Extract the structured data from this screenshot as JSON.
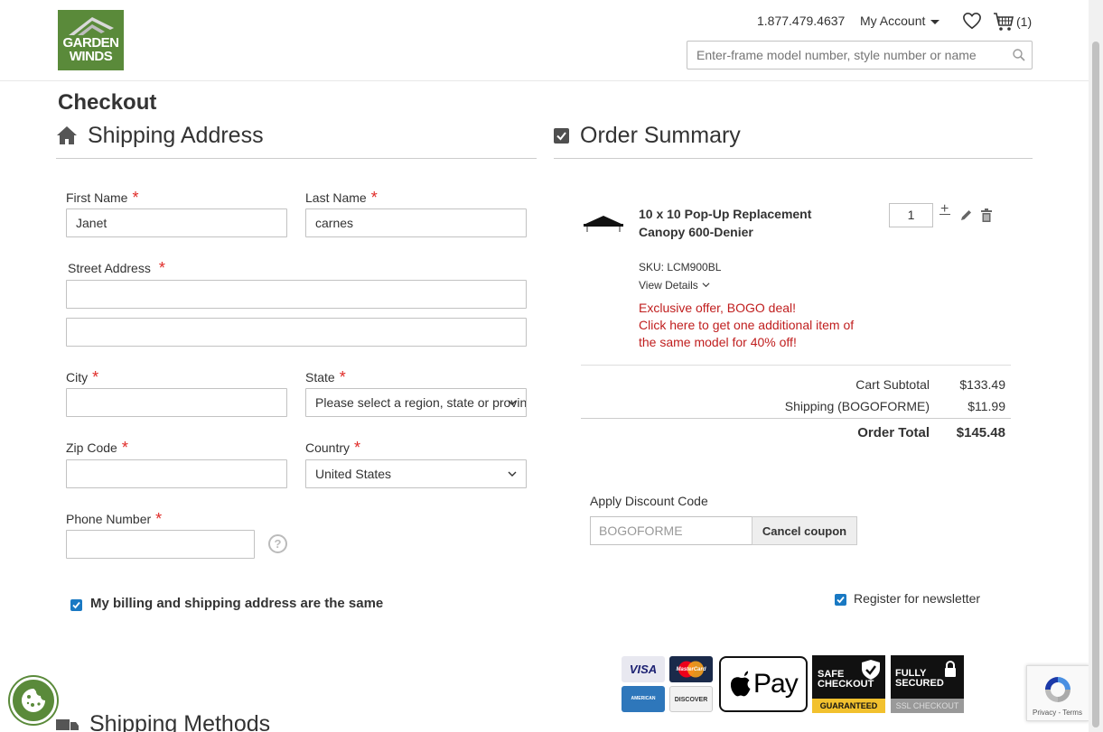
{
  "header": {
    "logo_line1": "GARDEN",
    "logo_line2": "WINDS",
    "phone": "1.877.479.4637",
    "account_label": "My Account",
    "cart_count": "(1)",
    "search_placeholder": "Enter-frame model number, style number or name"
  },
  "page": {
    "title": "Checkout"
  },
  "shipping": {
    "heading": "Shipping Address",
    "first_name_label": "First Name",
    "first_name_value": "Janet",
    "last_name_label": "Last Name",
    "last_name_value": "carnes",
    "street_label": "Street Address",
    "street_line1": "",
    "street_line2": "",
    "city_label": "City",
    "city_value": "",
    "state_label": "State",
    "state_value": "Please select a region, state or province.",
    "zip_label": "Zip Code",
    "zip_value": "",
    "country_label": "Country",
    "country_value": "United States",
    "phone_label": "Phone Number",
    "phone_value": "",
    "required_mark": "*",
    "help_mark": "?",
    "billing_same_label": "My billing and shipping address are the same",
    "billing_same_checked": true,
    "methods_heading": "Shipping Methods"
  },
  "order_summary": {
    "heading": "Order Summary",
    "item": {
      "name": "10 x 10 Pop-Up Replacement Canopy 600-Denier",
      "sku": "SKU: LCM900BL",
      "view_details": "View Details",
      "offer_line1": "Exclusive offer, BOGO deal!",
      "offer_line2": "Click here to get one additional item of the same model for 40% off!",
      "qty": "1",
      "plus": "+"
    },
    "totals": {
      "subtotal_label": "Cart Subtotal",
      "subtotal_value": "$133.49",
      "shipping_label": "Shipping (BOGOFORME)",
      "shipping_value": "$11.99",
      "total_label": "Order Total",
      "total_value": "$145.48"
    },
    "discount": {
      "label": "Apply Discount Code",
      "code": "BOGOFORME",
      "button": "Cancel coupon"
    },
    "newsletter_label": "Register for newsletter",
    "newsletter_checked": true
  },
  "badges": {
    "visa": "VISA",
    "mastercard": "MasterCard",
    "amex": "AMERICAN EXPRESS",
    "discover": "DISCOVER",
    "applepay": "Pay",
    "safe_line1": "SAFE",
    "safe_line2": "CHECKOUT",
    "safe_bottom": "GUARANTEED",
    "ssl_line1": "FULLY",
    "ssl_line2": "SECURED",
    "ssl_bottom": "SSL CHECKOUT"
  },
  "recaptcha": {
    "text": "Privacy - Terms"
  },
  "colors": {
    "brand_green": "#5a8a3a",
    "required_red": "#e02b27",
    "offer_red": "#c01e1e",
    "checkbox_blue": "#1979c3"
  }
}
